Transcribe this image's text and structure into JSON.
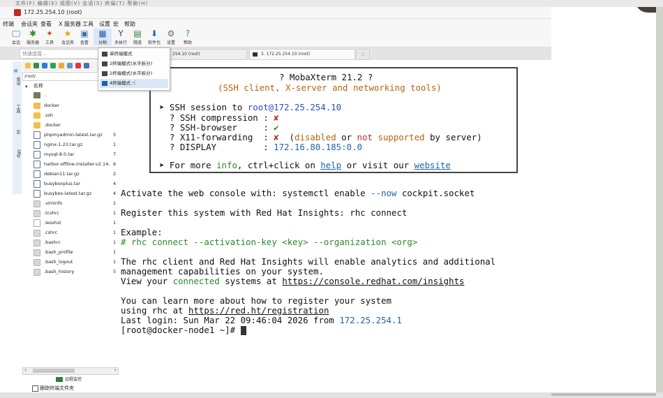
{
  "window": {
    "top_strip_text": "文件(F)  编辑(E)  视图(V)  会话(S)  终端(T)  帮助(H)",
    "title": "172.25.254.10 (root)"
  },
  "menu": [
    "终端",
    "会话夹",
    "查看",
    "X 服务器",
    "工具",
    "设置",
    "宏",
    "帮助"
  ],
  "toolbar": [
    {
      "icon": "session-icon",
      "glyph": "🖵",
      "color": "#2e64b5",
      "label": "会话"
    },
    {
      "icon": "servers-icon",
      "glyph": "✱",
      "color": "#2a8f2a",
      "label": "服务器"
    },
    {
      "icon": "tools-icon",
      "glyph": "✦",
      "color": "#d64b1e",
      "label": "工具"
    },
    {
      "icon": "folder-star-icon",
      "glyph": "★",
      "color": "#e0a800",
      "label": "会话夹"
    },
    {
      "icon": "view-icon",
      "glyph": "▣",
      "color": "#3a6ea8",
      "label": "查看"
    },
    {
      "icon": "split-icon",
      "glyph": "▦",
      "color": "#1b5fb8",
      "label": "分割"
    },
    {
      "icon": "multiexec-icon",
      "glyph": "Y",
      "color": "#7b1fa2",
      "label": "多执行"
    },
    {
      "icon": "tunneling-icon",
      "glyph": "▤",
      "color": "#2e7d32",
      "label": "隧道"
    },
    {
      "icon": "packages-icon",
      "glyph": "⬇",
      "color": "#1565c0",
      "label": "软件包"
    },
    {
      "icon": "settings-icon",
      "glyph": "⚙",
      "color": "#6a6a6a",
      "label": "设置"
    },
    {
      "icon": "help-icon",
      "glyph": "?",
      "color": "#1e88e5",
      "label": "帮助"
    }
  ],
  "quick_connect_placeholder": "快速连接...",
  "tabs": [
    {
      "label": "254.10 (root)"
    },
    {
      "label": "3. 172.25.254.10 (root)"
    }
  ],
  "split_menu": [
    {
      "label": "单终端模式"
    },
    {
      "label": "2终端模式(水平拆分)"
    },
    {
      "label": "2终端模式(水平拆分)"
    },
    {
      "label": "4终端模式"
    }
  ],
  "side_tabs": [
    "会话",
    "工具",
    "宏",
    "Sftp"
  ],
  "sftp": {
    "path": "/root/",
    "header_name": "名称",
    "files": [
      {
        "name": "..",
        "size": "",
        "kind": "up"
      },
      {
        "name": "docker",
        "size": "",
        "kind": "folder"
      },
      {
        "name": ".ssh",
        "size": "",
        "kind": "folder"
      },
      {
        "name": ".docker",
        "size": "",
        "kind": "folder"
      },
      {
        "name": "phpmyadmin-latest.tar.gz",
        "size": "5",
        "kind": "archive"
      },
      {
        "name": "nginx-1.23.tar.gz",
        "size": "1",
        "kind": "archive"
      },
      {
        "name": "mysql-8.0.tar",
        "size": "7",
        "kind": "archive"
      },
      {
        "name": "harbor-offline-installer-v2.14...",
        "size": "6",
        "kind": "archive"
      },
      {
        "name": "debian11.tar.gz",
        "size": "2",
        "kind": "archive"
      },
      {
        "name": "busyboxplus.tar",
        "size": "4",
        "kind": "archive"
      },
      {
        "name": "busybox-latest.tar.gz",
        "size": "4",
        "kind": "archive"
      },
      {
        "name": ".viminfo",
        "size": "1",
        "kind": "hidden"
      },
      {
        "name": ".tcshrc",
        "size": "1",
        "kind": "hidden"
      },
      {
        "name": ".lesshst",
        "size": "1",
        "kind": "file"
      },
      {
        "name": ".cshrc",
        "size": "1",
        "kind": "hidden"
      },
      {
        "name": ".bashrc",
        "size": "1",
        "kind": "hidden"
      },
      {
        "name": ".bash_profile",
        "size": "1",
        "kind": "hidden"
      },
      {
        "name": ".bash_logout",
        "size": "1",
        "kind": "hidden"
      },
      {
        "name": ".bash_history",
        "size": "5",
        "kind": "hidden"
      }
    ],
    "remote_monitor": "远程监控",
    "follow_folder": "跟踪终端文件夹"
  },
  "banner": {
    "title": "? MobaXterm 21.2 ?",
    "subtitle": "(SSH client, X-server and networking tools)",
    "session_prefix": "➤ SSH session to ",
    "session_target": "root@172.25.254.10",
    "rows": [
      {
        "key": "  ? SSH compression : ",
        "val": "✘",
        "cls": "red"
      },
      {
        "key": "  ? SSH-browser     : ",
        "val": "✔",
        "cls": "green"
      },
      {
        "key": "  ? X11-forwarding  : ",
        "val": "✘",
        "cls": "red"
      },
      {
        "key": "  ? DISPLAY         : ",
        "val": "172.16.80.185:0.0",
        "cls": "blue"
      }
    ],
    "x11_note_1": "  (",
    "x11_note_disabled": "disabled",
    "x11_note_or": " or ",
    "x11_note_not": "not",
    "x11_note_supported": " supported",
    "x11_note_end": " by server)",
    "more_1": "➤ For more ",
    "more_info": "info",
    "more_2": ", ctrl+click on ",
    "more_help": "help",
    "more_3": " or visit our ",
    "more_website": "website"
  },
  "terminal": {
    "l1a": "Activate the web console with: systemctl enable ",
    "l1b": "--now",
    "l1c": " cockpit.socket",
    "l2": "Register this system with Red Hat Insights: rhc connect",
    "l3": "Example:",
    "l4": "# rhc connect --activation-key <key> --organization <org>",
    "l5": "The rhc client and Red Hat Insights will enable analytics and additional",
    "l6": "management capabilities on your system.",
    "l7a": "View your ",
    "l7b": "connected",
    "l7c": " systems at ",
    "l7d": "https://console.redhat.com/insights",
    "l8": "You can learn more about how to register your system",
    "l9a": "using rhc at ",
    "l9b": "https://red.ht/registration",
    "l10a": "Last login: Sun Mar 22 09:46:04 2026 from ",
    "l10b": "172.25.254.1",
    "prompt": "[root@docker-node1 ~]# "
  }
}
